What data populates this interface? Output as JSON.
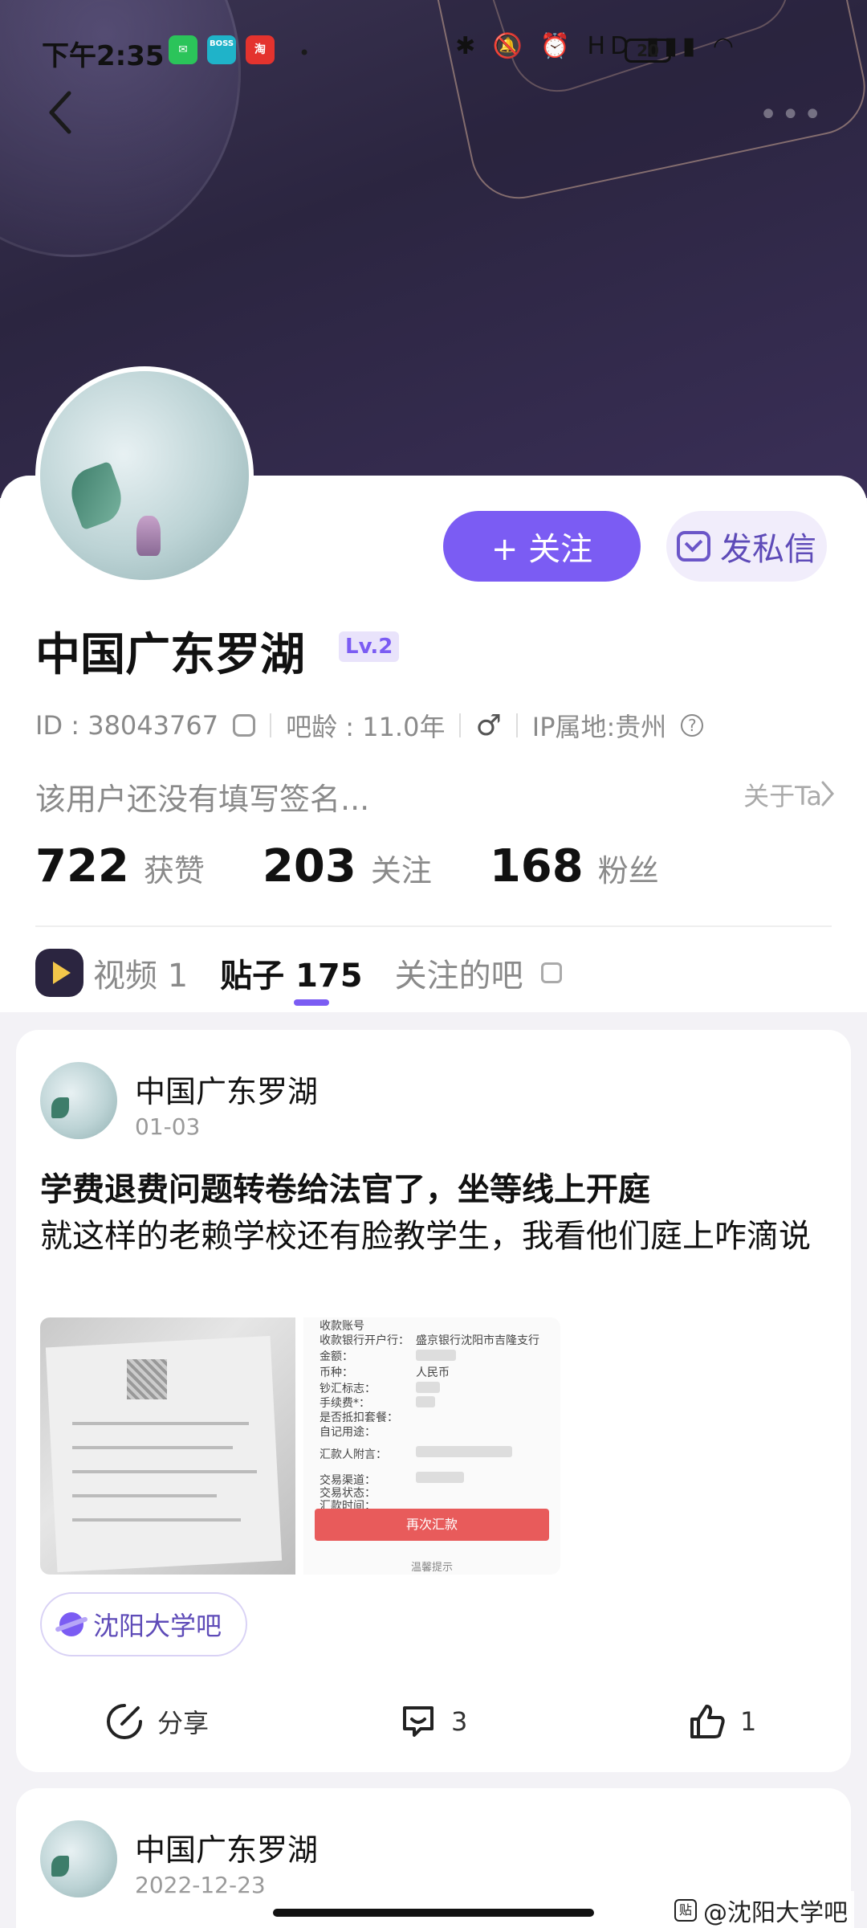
{
  "status_bar": {
    "time": "下午2:35",
    "apps": [
      "微信",
      "BOSS直聘",
      "淘宝"
    ],
    "dot": "•",
    "indicators": "✱ 🔕 ⏰ HD ▮▮▮ ◠",
    "battery": "20"
  },
  "profile": {
    "name": "中国广东罗湖",
    "level": "Lv.2",
    "id_label": "ID : 38043767",
    "bar_age": "吧龄 : 11.0年",
    "gender": "♂",
    "ip": "IP属地:贵州",
    "signature": "该用户还没有填写签名...",
    "about_label": "关于Ta",
    "follow_label": "+ 关注",
    "message_label": "发私信"
  },
  "stats": [
    {
      "num": "722",
      "label": "获赞"
    },
    {
      "num": "203",
      "label": "关注"
    },
    {
      "num": "168",
      "label": "粉丝"
    }
  ],
  "tabs": {
    "video": "视频 1",
    "posts": "贴子 175",
    "followed_bars": "关注的吧"
  },
  "post1": {
    "author": "中国广东罗湖",
    "date": "01-03",
    "title": "学费退费问题转卷给法官了，坐等线上开庭",
    "body": "就这样的老赖学校还有脸教学生，我看他们庭上咋滴说",
    "image2": {
      "rows": [
        "收款账号",
        "收款银行开户行：",
        "金额：",
        "币种：",
        "钞汇标志：",
        "手续费*：",
        "是否抵扣套餐：",
        "自记用途：",
        "汇款人附言：",
        "交易渠道：",
        "交易状态：",
        "汇款时间："
      ],
      "bank": "盛京银行沈阳市吉隆支行",
      "currency": "人民币",
      "button": "再次汇款",
      "tip": "温馨提示"
    },
    "tag": "沈阳大学吧",
    "share": "分享",
    "comments": "3",
    "likes": "1"
  },
  "post2": {
    "author": "中国广东罗湖",
    "date": "2022-12-23"
  },
  "watermark": "@沈阳大学吧",
  "watermark_icon": "贴"
}
